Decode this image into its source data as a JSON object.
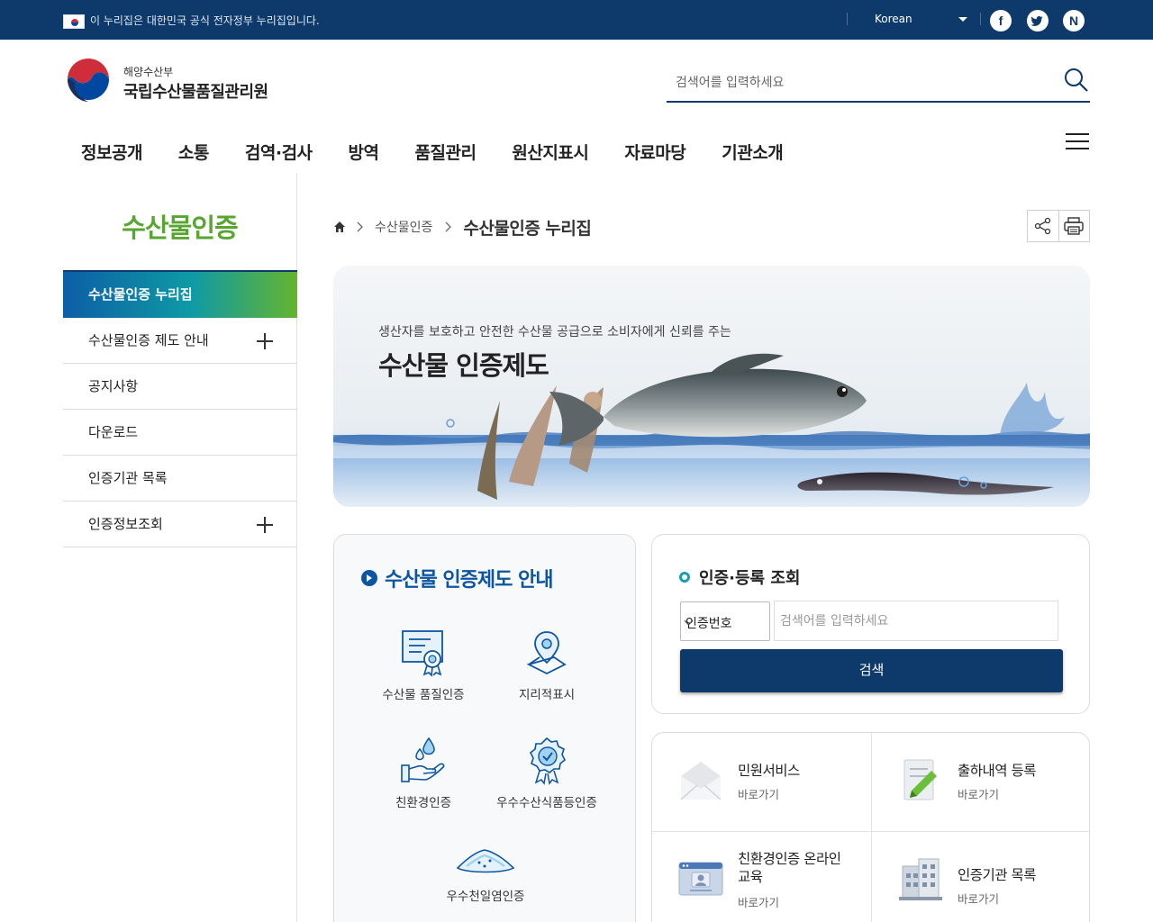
{
  "gov_banner": {
    "text": "이 누리집은 대한민국 공식 전자정부 누리집입니다.",
    "language": "Korean",
    "social": [
      {
        "name": "facebook",
        "glyph": "f"
      },
      {
        "name": "twitter",
        "glyph": "t"
      },
      {
        "name": "naver-blog",
        "glyph": "N"
      }
    ]
  },
  "header": {
    "logo_sub": "해양수산부",
    "logo_main": "국립수산물품질관리원",
    "search_placeholder": "검색어를 입력하세요"
  },
  "gnb": [
    "정보공개",
    "소통",
    "검역·검사",
    "방역",
    "품질관리",
    "원산지표시",
    "자료마당",
    "기관소개"
  ],
  "sidebar": {
    "title": "수산물인증",
    "items": [
      {
        "label": "수산물인증 누리집",
        "active": true,
        "expandable": false
      },
      {
        "label": "수산물인증 제도 안내",
        "active": false,
        "expandable": true
      },
      {
        "label": "공지사항",
        "active": false,
        "expandable": false
      },
      {
        "label": "다운로드",
        "active": false,
        "expandable": false
      },
      {
        "label": "인증기관 목록",
        "active": false,
        "expandable": false
      },
      {
        "label": "인증정보조회",
        "active": false,
        "expandable": true
      }
    ]
  },
  "breadcrumb": {
    "middle": "수산물인증",
    "current": "수산물인증 누리집"
  },
  "banner": {
    "subtitle": "생산자를 보호하고 안전한 수산물 공급으로 소비자에게 신뢰를 주는",
    "title": "수산물 인증제도"
  },
  "info": {
    "title": "수산물 인증제도 안내",
    "items": [
      {
        "label": "수산물 품질인증",
        "icon": "certificate-icon"
      },
      {
        "label": "지리적표시",
        "icon": "map-pin-icon"
      },
      {
        "label": "친환경인증",
        "icon": "water-hand-icon"
      },
      {
        "label": "우수수산식품등인증",
        "icon": "badge-check-icon"
      },
      {
        "label": "우수천일염인증",
        "icon": "salt-pile-icon"
      }
    ]
  },
  "lookup": {
    "title": "인증·등록 조회",
    "select_value": "인증번호",
    "input_placeholder": "검색어를 입력하세요",
    "button": "검색"
  },
  "quick": [
    {
      "title": "민원서비스",
      "link": "바로가기",
      "icon": "envelope-icon"
    },
    {
      "title": "출하내역 등록",
      "link": "바로가기",
      "icon": "document-pen-icon"
    },
    {
      "title": "친환경인증 온라인 교육",
      "title_line1": "친환경인증 온라인",
      "title_line2": "교육",
      "link": "바로가기",
      "icon": "online-education-icon"
    },
    {
      "title": "인증기관 목록",
      "link": "바로가기",
      "icon": "building-icon"
    }
  ],
  "colors": {
    "navy": "#0d3a6b",
    "accent_green": "#58a631",
    "info_blue": "#0d55a0",
    "teal": "#1aa0a8"
  }
}
